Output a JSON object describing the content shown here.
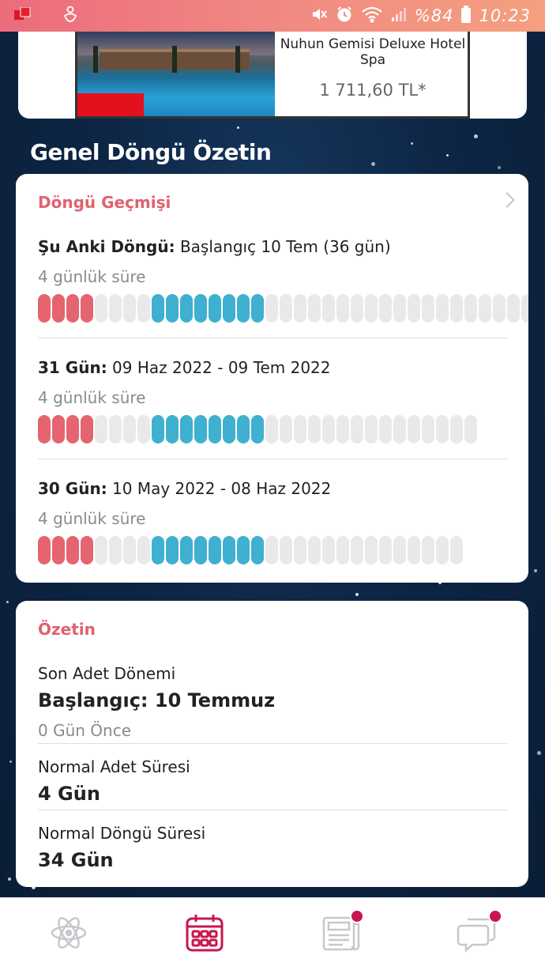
{
  "status_bar": {
    "battery_percent": "%84",
    "time": "10:23",
    "icons": [
      "app-notification-icon",
      "baby-icon",
      "mute-icon",
      "alarm-icon",
      "wifi-icon",
      "signal-icon",
      "battery-icon"
    ]
  },
  "ad": {
    "hotel_name": "Nuhun Gemisi Deluxe Hotel Spa",
    "price": "1 711,60 TL*"
  },
  "section_title": "Genel Döngü Özetin",
  "history": {
    "header": "Döngü Geçmişi",
    "cycles": [
      {
        "label": "Şu Anki Döngü:",
        "range": "Başlangıç 10 Tem (36 gün)",
        "period_text": "4 günlük süre",
        "total_days": 36,
        "period_days": 4,
        "fertile_start": 8,
        "fertile_days": 8
      },
      {
        "label": "31 Gün:",
        "range": "09 Haz 2022 - 09 Tem 2022",
        "period_text": "4 günlük süre",
        "total_days": 31,
        "period_days": 4,
        "fertile_start": 8,
        "fertile_days": 8
      },
      {
        "label": "30 Gün:",
        "range": "10 May 2022 - 08 Haz 2022",
        "period_text": "4 günlük süre",
        "total_days": 30,
        "period_days": 4,
        "fertile_start": 8,
        "fertile_days": 8
      }
    ]
  },
  "summary": {
    "header": "Özetin",
    "last_period_label": "Son Adet Dönemi",
    "last_period_value": "Başlangıç: 10 Temmuz",
    "last_period_note": "0 Gün Önce",
    "normal_period_label": "Normal Adet Süresi",
    "normal_period_value": "4 Gün",
    "normal_cycle_label": "Normal Döngü Süresi",
    "normal_cycle_value": "34 Gün"
  },
  "nav": {
    "items": [
      "atom-icon",
      "calendar-icon",
      "news-icon",
      "chat-icon"
    ],
    "active_color": "#c8174f",
    "inactive_color": "#c7c7cc"
  },
  "colors": {
    "period": "#e46470",
    "fertile": "#3fb0cf",
    "empty": "#e9e9ec",
    "accent": "#e0626d"
  }
}
